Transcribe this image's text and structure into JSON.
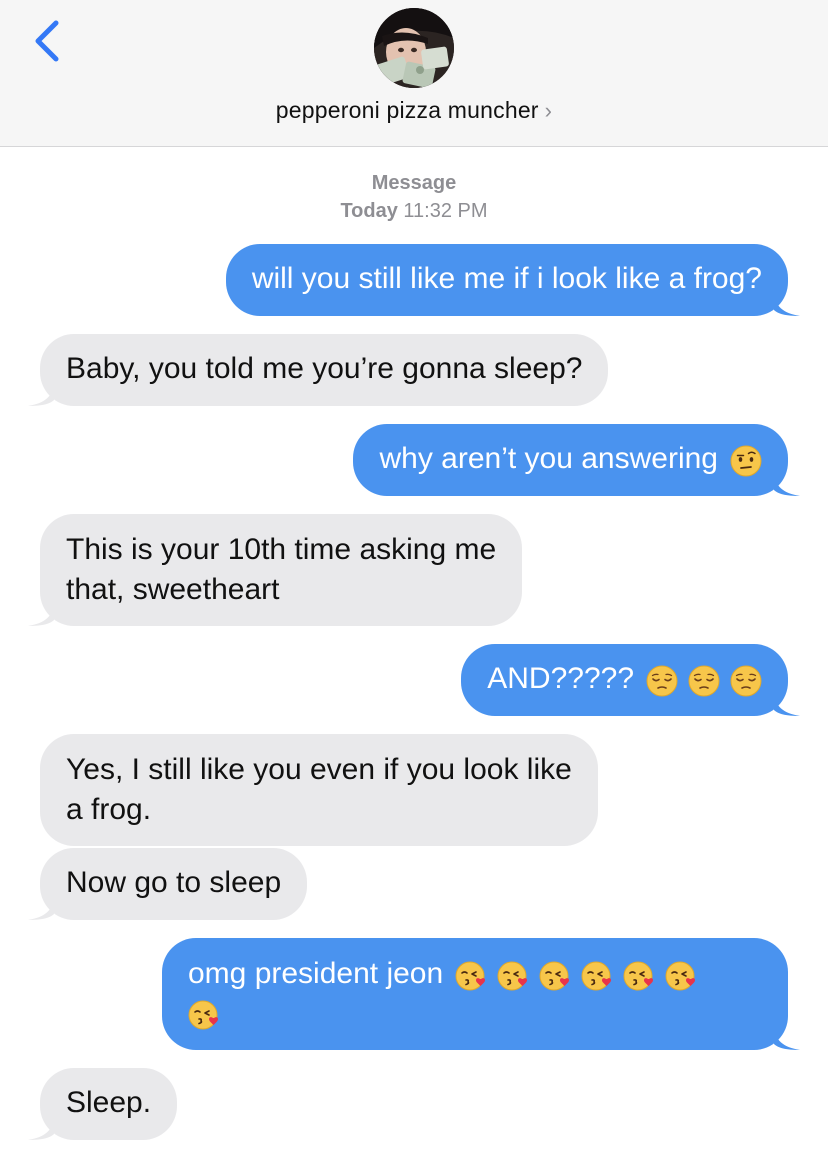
{
  "header": {
    "contact_name": "pepperoni pizza muncher",
    "chevron": "›",
    "back_icon": "chevron-left-icon"
  },
  "meta": {
    "service": "Message",
    "day": "Today",
    "time": "11:32 PM"
  },
  "colors": {
    "outgoing_bubble": "#4a93ef",
    "incoming_bubble": "#e9e9eb",
    "back_button": "#3478f6"
  },
  "messages": [
    {
      "direction": "outgoing",
      "text": "will you still like me if i look like a frog?"
    },
    {
      "direction": "incoming",
      "text": "Baby, you told me you’re gonna sleep?"
    },
    {
      "direction": "outgoing",
      "text": "why aren’t you answering",
      "emojis": [
        "raised-eyebrow-face"
      ]
    },
    {
      "direction": "incoming",
      "lines": [
        "This is your 10th time asking me",
        "that, sweetheart"
      ]
    },
    {
      "direction": "outgoing",
      "text": "AND?????",
      "emojis": [
        "pensive-face",
        "pensive-face",
        "pensive-face"
      ]
    },
    {
      "direction": "incoming",
      "lines": [
        "Yes, I still like you even if you look like",
        "a frog."
      ]
    },
    {
      "direction": "incoming",
      "text": "Now go to sleep"
    },
    {
      "direction": "outgoing",
      "text": "omg president jeon",
      "emojis": [
        "kissing-heart-face",
        "kissing-heart-face",
        "kissing-heart-face",
        "kissing-heart-face",
        "kissing-heart-face",
        "kissing-heart-face",
        "kissing-heart-face"
      ]
    },
    {
      "direction": "incoming",
      "text": "Sleep."
    }
  ]
}
